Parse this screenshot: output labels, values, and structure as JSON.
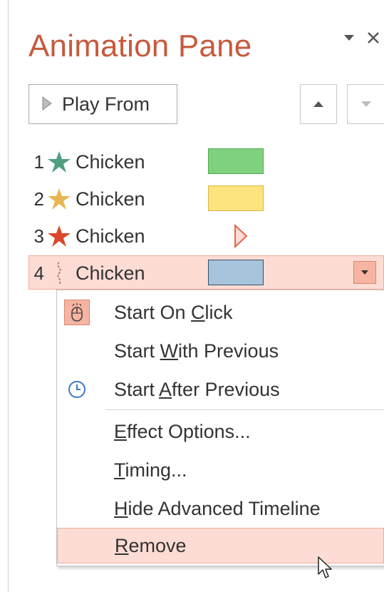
{
  "pane": {
    "title": "Animation Pane",
    "play_from_label": "Play From"
  },
  "animations": [
    {
      "number": "1",
      "name": "Chicken",
      "effect_icon": "green-star-entrance-icon",
      "bar_color": "#7ed17e"
    },
    {
      "number": "2",
      "name": "Chicken",
      "effect_icon": "gold-star-emphasis-icon",
      "bar_color": "#fde47f"
    },
    {
      "number": "3",
      "name": "Chicken",
      "effect_icon": "red-star-exit-icon",
      "bar_color": "#f6a79a"
    },
    {
      "number": "4",
      "name": "Chicken",
      "effect_icon": "motion-path-icon",
      "bar_color": "#a6c5dc"
    }
  ],
  "menu": {
    "start_on_click": {
      "pre": "Start On ",
      "key": "C",
      "post": "lick"
    },
    "start_with_previous": {
      "pre": "Start ",
      "key": "W",
      "post": "ith Previous"
    },
    "start_after_previous": {
      "pre": "Start ",
      "key": "A",
      "post": "fter Previous"
    },
    "effect_options": {
      "pre": "",
      "key": "E",
      "post": "ffect Options..."
    },
    "timing": {
      "pre": "",
      "key": "T",
      "post": "iming..."
    },
    "hide_advanced_timeline": {
      "pre": "",
      "key": "H",
      "post": "ide Advanced Timeline"
    },
    "remove": {
      "pre": "",
      "key": "R",
      "post": "emove"
    }
  },
  "colors": {
    "accent": "#c75a3e",
    "selection_fill": "#fcdcd4",
    "selection_border": "#f4aa96"
  }
}
